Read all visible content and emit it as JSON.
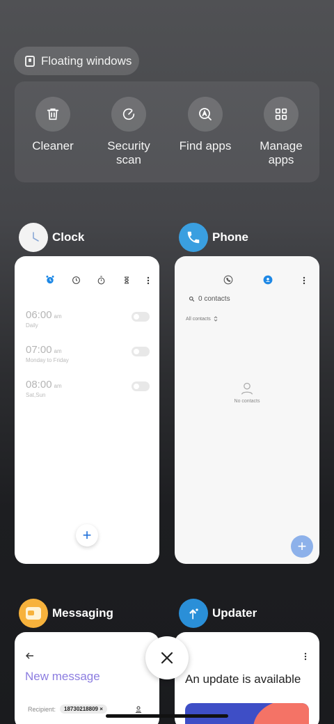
{
  "floating_windows": {
    "label": "Floating windows",
    "icon": "floating-window-icon"
  },
  "tools": [
    {
      "label": "Cleaner",
      "icon": "trash-icon"
    },
    {
      "label": "Security scan",
      "icon": "security-scan-icon"
    },
    {
      "label": "Find apps",
      "icon": "find-apps-icon"
    },
    {
      "label": "Manage apps",
      "icon": "grid-icon"
    }
  ],
  "apps": {
    "clock": {
      "name": "Clock",
      "alarms": [
        {
          "time": "06:00",
          "ampm": "am",
          "repeat": "Daily"
        },
        {
          "time": "07:00",
          "ampm": "am",
          "repeat": "Monday to Friday"
        },
        {
          "time": "08:00",
          "ampm": "am",
          "repeat": "Sat,Sun"
        }
      ],
      "fab": "+"
    },
    "phone": {
      "name": "Phone",
      "search": "0 contacts",
      "filter": "All contacts",
      "empty": "No contacts",
      "fab": "+"
    },
    "messaging": {
      "name": "Messaging",
      "title": "New message",
      "recipient_label": "Recipient:",
      "recipient_chip": "18730218809 ×"
    },
    "updater": {
      "name": "Updater",
      "title": "An update is available"
    }
  },
  "colors": {
    "accent_blue": "#1e88e5",
    "phone_icon": "#3a9fe0",
    "messaging_icon": "#f7b23c",
    "updater_icon": "#2a8fd8"
  }
}
